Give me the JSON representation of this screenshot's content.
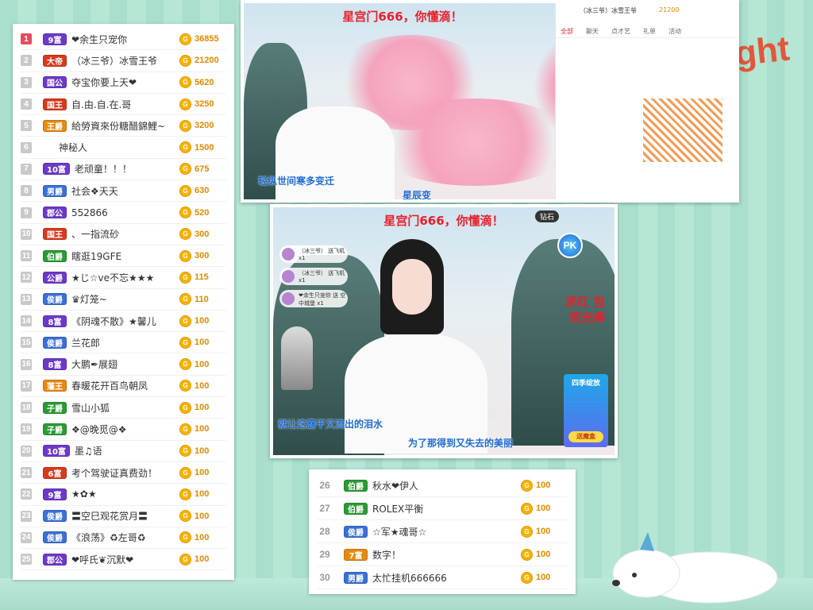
{
  "left_ranking": [
    {
      "rank": "1",
      "badge": "9富",
      "color": "b-purple",
      "name": "❤余生只宠你",
      "score": "36855"
    },
    {
      "rank": "2",
      "badge": "大帝",
      "color": "b-red",
      "name": "（冰三爷）冰雪王爷",
      "score": "21200"
    },
    {
      "rank": "3",
      "badge": "国公",
      "color": "b-purple",
      "name": "夺宝你要上天❤",
      "score": "5620"
    },
    {
      "rank": "4",
      "badge": "国王",
      "color": "b-red",
      "name": "自.由.自.在.哥",
      "score": "3250"
    },
    {
      "rank": "5",
      "badge": "王爵",
      "color": "b-orange",
      "name": "給勞資來份糖醋錦鯉~",
      "score": "3200"
    },
    {
      "rank": "6",
      "badge": "",
      "color": "b-black",
      "name": "神秘人",
      "score": "1500"
    },
    {
      "rank": "7",
      "badge": "10富",
      "color": "b-purple",
      "name": "老顽童！！！",
      "score": "675"
    },
    {
      "rank": "8",
      "badge": "男爵",
      "color": "b-blue",
      "name": "社会❖天天",
      "score": "630"
    },
    {
      "rank": "9",
      "badge": "郡公",
      "color": "b-purple",
      "name": "552866",
      "score": "520"
    },
    {
      "rank": "10",
      "badge": "国王",
      "color": "b-red",
      "name": "、一指流砂",
      "score": "300"
    },
    {
      "rank": "11",
      "badge": "伯爵",
      "color": "b-green",
      "name": "瞎逛19GFE",
      "score": "300"
    },
    {
      "rank": "12",
      "badge": "公爵",
      "color": "b-purple",
      "name": "★じ☆ve不忘★★★",
      "score": "115"
    },
    {
      "rank": "13",
      "badge": "侯爵",
      "color": "b-blue",
      "name": "♛灯笼~",
      "score": "110"
    },
    {
      "rank": "14",
      "badge": "8富",
      "color": "b-purple",
      "name": "《阴魂不散》★馨儿",
      "score": "100"
    },
    {
      "rank": "15",
      "badge": "侯爵",
      "color": "b-blue",
      "name": "兰花郎",
      "score": "100"
    },
    {
      "rank": "16",
      "badge": "8富",
      "color": "b-purple",
      "name": "大鹏✒展翅",
      "score": "100"
    },
    {
      "rank": "17",
      "badge": "藩王",
      "color": "b-orange",
      "name": "春暖花开百鸟朝凤",
      "score": "100"
    },
    {
      "rank": "18",
      "badge": "子爵",
      "color": "b-green",
      "name": "雪山小狐",
      "score": "100"
    },
    {
      "rank": "19",
      "badge": "子爵",
      "color": "b-green",
      "name": "❖@晚觅@❖",
      "score": "100"
    },
    {
      "rank": "20",
      "badge": "10富",
      "color": "b-purple",
      "name": "墨♫语",
      "score": "100"
    },
    {
      "rank": "21",
      "badge": "6富",
      "color": "b-red",
      "name": "考个驾驶证真费劲！",
      "score": "100"
    },
    {
      "rank": "22",
      "badge": "9富",
      "color": "b-purple",
      "name": "★✿★",
      "score": "100"
    },
    {
      "rank": "23",
      "badge": "侯爵",
      "color": "b-blue",
      "name": "〓空巳观花赏月〓",
      "score": "100"
    },
    {
      "rank": "24",
      "badge": "侯爵",
      "color": "b-blue",
      "name": "《浪荡》♻左哥♻",
      "score": "100"
    },
    {
      "rank": "25",
      "badge": "郡公",
      "color": "b-purple",
      "name": "❤呼氏❦沉默❤",
      "score": "100"
    }
  ],
  "right_ranking": [
    {
      "rank": "26",
      "badge": "伯爵",
      "color": "b-green",
      "name": "秋水❤伊人",
      "score": "100"
    },
    {
      "rank": "27",
      "badge": "伯爵",
      "color": "b-green",
      "name": "ROLEX平衡",
      "score": "100"
    },
    {
      "rank": "28",
      "badge": "侯爵",
      "color": "b-blue",
      "name": "☆军★魂哥☆",
      "score": "100"
    },
    {
      "rank": "29",
      "badge": "7富",
      "color": "b-orange",
      "name": "数字！",
      "score": "100"
    },
    {
      "rank": "30",
      "badge": "男爵",
      "color": "b-blue",
      "name": "太忙挂机666666",
      "score": "100"
    }
  ],
  "coin_glyph": "G",
  "top_video": {
    "title": "星宫门666，你懂滴！",
    "caption": "轻纵世间寒多变迁",
    "caption2": "星辰变",
    "chat_tabs": [
      "全部",
      "聊天",
      "点才艺",
      "礼单",
      "活动"
    ],
    "chat_user": "（冰三爷）冰雪王爷",
    "chat_score": "21200"
  },
  "mid_video": {
    "title": "星宫门666，你懂滴！",
    "caption1": "就让这露干又流出的泪水",
    "caption2": "为了那得到又失去的美丽",
    "side1": "求红 包",
    "side2": "荧光棒",
    "pk": "PK",
    "diamond": "钻石",
    "promo_title": "四季绽放",
    "promo_btn": "送魔盒",
    "gifts": [
      {
        "user": "（冰三爷）",
        "gift": "送飞机",
        "count": "x1"
      },
      {
        "user": "（冰三爷）",
        "gift": "送飞机",
        "count": "x1"
      },
      {
        "user": "❤余生只宠你",
        "gift": "送 空中城堡",
        "count": "x1"
      }
    ]
  },
  "deco_text": "ght"
}
